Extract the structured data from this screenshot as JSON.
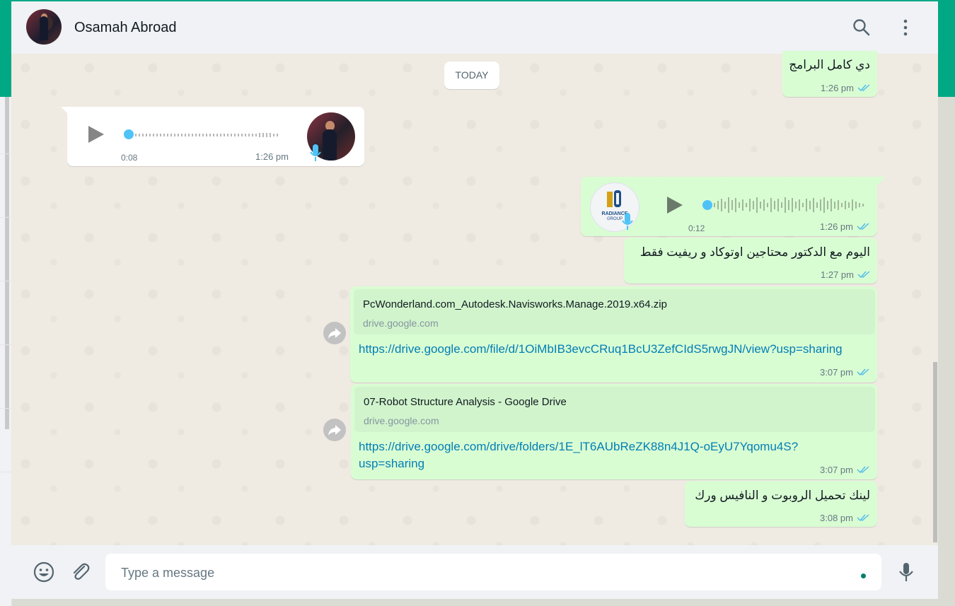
{
  "header": {
    "contact_name": "Osamah Abroad"
  },
  "date_chip": "TODAY",
  "messages": [
    {
      "id": "m1",
      "type": "text",
      "text": "دي كامل البرامج",
      "time": "1:26 pm"
    },
    {
      "id": "m2",
      "type": "voice",
      "direction": "incoming",
      "duration": "0:08",
      "time": "1:26 pm"
    },
    {
      "id": "m3",
      "type": "voice",
      "direction": "outgoing",
      "duration": "0:12",
      "time": "1:26 pm",
      "avatar_label_1": "RADIANCE",
      "avatar_label_2": "GROUP"
    },
    {
      "id": "m4",
      "type": "text",
      "text": "اليوم مع الدكتور محتاجين اوتوكاد و ريفيت فقط",
      "time": "1:27 pm"
    },
    {
      "id": "m5",
      "type": "link",
      "preview_title": "PcWonderland.com_Autodesk.Navisworks.Manage.2019.x64.zip",
      "preview_domain": "drive.google.com",
      "url": "https://drive.google.com/file/d/1OiMbIB3evcCRuq1BcU3ZefCIdS5rwgJN/view?usp=sharing",
      "time": "3:07 pm"
    },
    {
      "id": "m6",
      "type": "link",
      "preview_title": "07-Robot Structure Analysis - Google Drive",
      "preview_domain": "drive.google.com",
      "url_line1": "https://drive.google.com/drive/folders/1E_lT6AUbReZK88n4J1Q-oEyU7Yqomu4S?",
      "url_line2": "usp=sharing",
      "time": "3:07 pm"
    },
    {
      "id": "m7",
      "type": "text",
      "text": "لينك تحميل الروبوت و النافيس ورك",
      "time": "3:08 pm"
    }
  ],
  "composer": {
    "placeholder": "Type a message"
  },
  "icons": [
    "search-icon",
    "menu-icon",
    "emoji-icon",
    "attach-icon",
    "mic-icon",
    "forward-icon",
    "play-icon",
    "double-check-icon"
  ],
  "colors": {
    "outgoing": "#d9fdd3",
    "incoming": "#ffffff",
    "accent": "#00a884",
    "link": "#027eb5",
    "ticks": "#53bdeb"
  }
}
